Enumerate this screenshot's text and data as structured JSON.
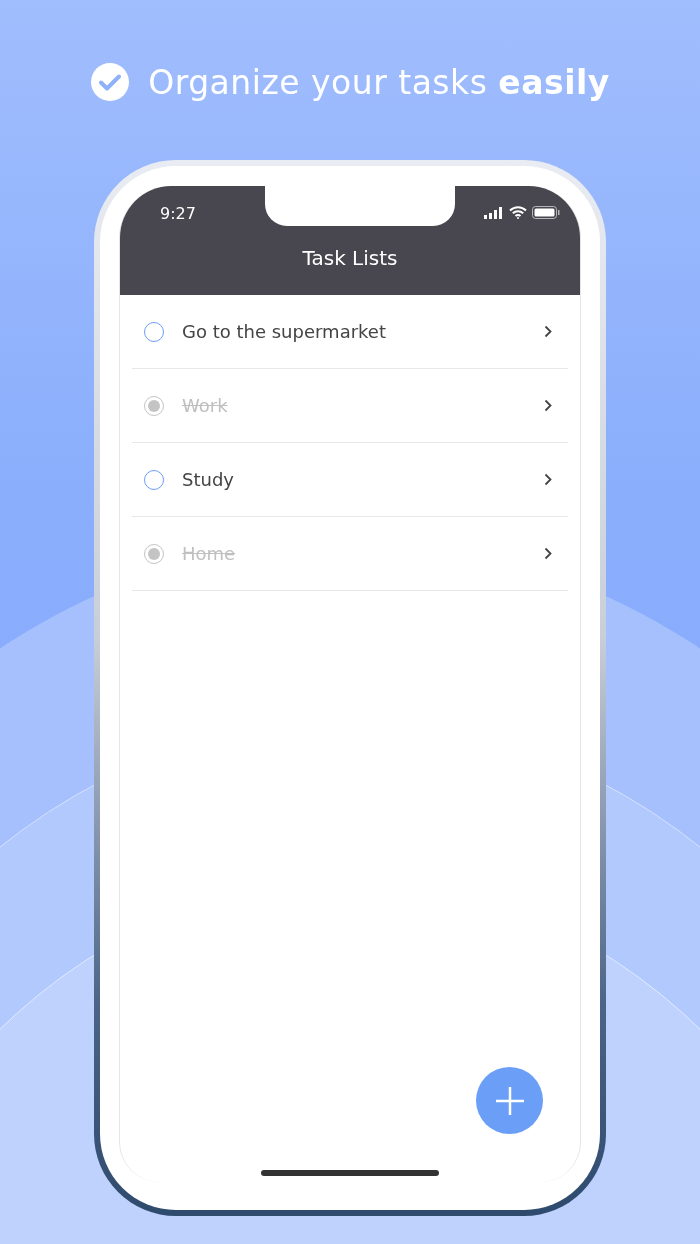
{
  "headline": "Organize your tasks **easily**",
  "status_bar": {
    "time": "9:27"
  },
  "title": "Task Lists",
  "tasks": [
    {
      "label": "Go to the supermarket",
      "done": false
    },
    {
      "label": "Work",
      "done": true
    },
    {
      "label": "Study",
      "done": false
    },
    {
      "label": "Home",
      "done": true
    }
  ]
}
